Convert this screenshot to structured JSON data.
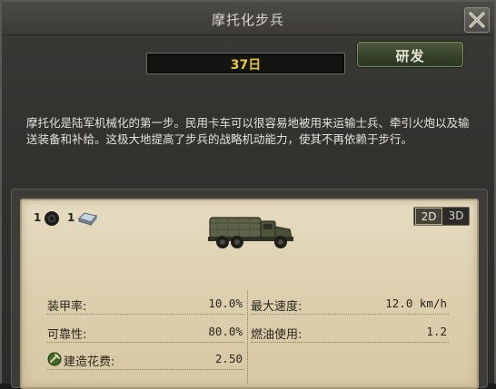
{
  "window": {
    "title": "摩托化步兵"
  },
  "days": "37日",
  "research_button": "研发",
  "description": "摩托化是陆军机械化的第一步。民用卡车可以很容易地被用来运输士兵、牵引火炮以及输送装备和补给。这极大地提高了步兵的战略机动能力，使其不再依赖于步行。",
  "requirements": [
    {
      "count": "1",
      "icon": "tire-icon"
    },
    {
      "count": "1",
      "icon": "steel-icon"
    }
  ],
  "view_modes": [
    "2D",
    "3D"
  ],
  "active_view": "2D",
  "stats": {
    "armor": {
      "label": "装甲率:",
      "value": "10.0%"
    },
    "max_speed": {
      "label": "最大速度:",
      "value": "12.0 km/h"
    },
    "reliability": {
      "label": "可靠性:",
      "value": "80.0%"
    },
    "fuel_usage": {
      "label": "燃油使用:",
      "value": "1.2"
    },
    "build_cost": {
      "label": "建造花费:",
      "value": "2.50"
    }
  },
  "colors": {
    "days_text": "#e8c840",
    "panel_bg": "#dccfae",
    "research_button": "#37432b"
  }
}
